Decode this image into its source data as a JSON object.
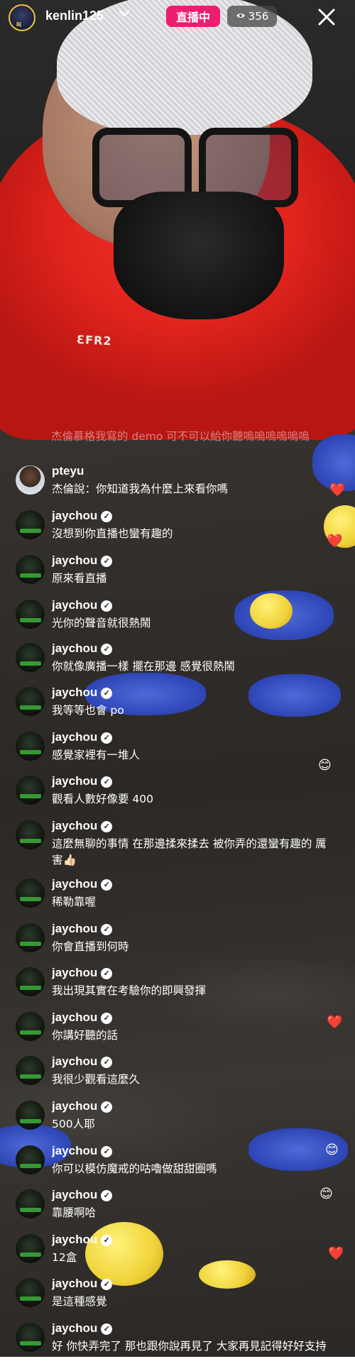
{
  "header": {
    "username": "kenlin125",
    "avatar_text": "叫",
    "live_label": "直播中",
    "viewer_count": "356",
    "close_icon": "close-icon"
  },
  "faded_comment": "杰倫慕格我寫的 demo 可不可以給你聽嗚嗚嗚嗚嗚嗚",
  "comments": [
    {
      "user": "pteyu",
      "verified": false,
      "text": "杰倫說：你知道我為什麼上來看你嗎"
    },
    {
      "user": "jaychou",
      "verified": true,
      "text": "沒想到你直播也蠻有趣的"
    },
    {
      "user": "jaychou",
      "verified": true,
      "text": "原來看直播"
    },
    {
      "user": "jaychou",
      "verified": true,
      "text": "光你的聲音就很熱鬧"
    },
    {
      "user": "jaychou",
      "verified": true,
      "text": "你就像廣播一樣 擺在那邊 感覺很熱鬧"
    },
    {
      "user": "jaychou",
      "verified": true,
      "text": "我等等也會 po"
    },
    {
      "user": "jaychou",
      "verified": true,
      "text": "感覺家裡有一堆人"
    },
    {
      "user": "jaychou",
      "verified": true,
      "text": "觀看人數好像要 400"
    },
    {
      "user": "jaychou",
      "verified": true,
      "text": "這麼無聊的事情 在那邊揉來揉去 被你弄的還蠻有趣的 厲害👍🏻"
    },
    {
      "user": "jaychou",
      "verified": true,
      "text": "稀勒靠喔"
    },
    {
      "user": "jaychou",
      "verified": true,
      "text": "你會直播到何時"
    },
    {
      "user": "jaychou",
      "verified": true,
      "text": "我出現其實在考驗你的即興發揮"
    },
    {
      "user": "jaychou",
      "verified": true,
      "text": "你講好聽的話"
    },
    {
      "user": "jaychou",
      "verified": true,
      "text": "我很少觀看這麼久"
    },
    {
      "user": "jaychou",
      "verified": true,
      "text": "500人耶"
    },
    {
      "user": "jaychou",
      "verified": true,
      "text": "你可以模仿魔戒的咕嚕做甜甜圈嗎"
    },
    {
      "user": "jaychou",
      "verified": true,
      "text": "靠腰啊哈"
    },
    {
      "user": "jaychou",
      "verified": true,
      "text": "12盒"
    },
    {
      "user": "jaychou",
      "verified": true,
      "text": "是這種感覺"
    },
    {
      "user": "jaychou",
      "verified": true,
      "text": "好 你快弄完了 那也跟你說再見了 大家再見記得好好支持這個白痴啊"
    }
  ],
  "colors": {
    "live_badge": "#ee1d6f",
    "shirt": "#e0231d",
    "glove": "#2e46b5"
  }
}
